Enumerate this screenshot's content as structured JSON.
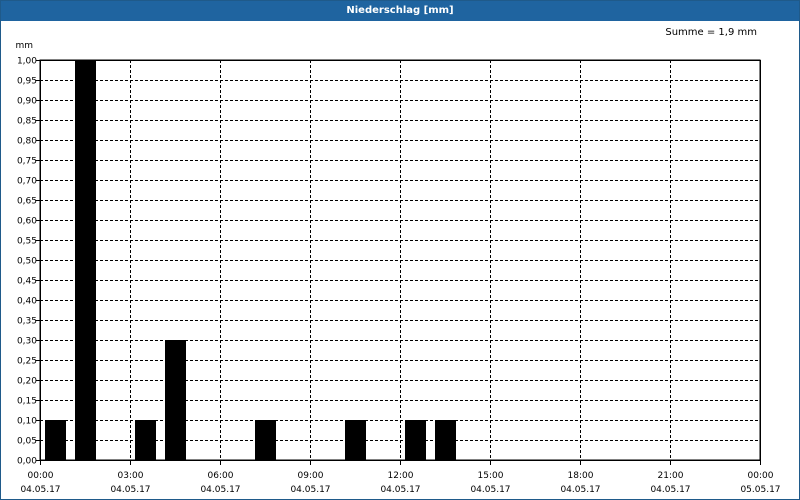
{
  "window": {
    "title": "Niederschlag [mm]"
  },
  "summary": "Summe = 1,9 mm",
  "chart_data": {
    "type": "bar",
    "title": "Niederschlag [mm]",
    "ylabel": "mm",
    "ylim": [
      0,
      1.0
    ],
    "y_ticks": [
      "0,00",
      "0,05",
      "0,10",
      "0,15",
      "0,20",
      "0,25",
      "0,30",
      "0,35",
      "0,40",
      "0,45",
      "0,50",
      "0,55",
      "0,60",
      "0,65",
      "0,70",
      "0,75",
      "0,80",
      "0,85",
      "0,90",
      "0,95",
      "1,00"
    ],
    "x_ticks": [
      {
        "time": "00:00",
        "date": "04.05.17"
      },
      {
        "time": "03:00",
        "date": "04.05.17"
      },
      {
        "time": "06:00",
        "date": "04.05.17"
      },
      {
        "time": "09:00",
        "date": "04.05.17"
      },
      {
        "time": "12:00",
        "date": "04.05.17"
      },
      {
        "time": "15:00",
        "date": "04.05.17"
      },
      {
        "time": "18:00",
        "date": "04.05.17"
      },
      {
        "time": "21:00",
        "date": "04.05.17"
      },
      {
        "time": "00:00",
        "date": "05.05.17"
      }
    ],
    "grid": true,
    "bar_color": "#000000",
    "bars": [
      {
        "time": "04.05.17 00:00",
        "value": 0.1
      },
      {
        "time": "04.05.17 01:00",
        "value": 1.0
      },
      {
        "time": "04.05.17 03:00",
        "value": 0.1
      },
      {
        "time": "04.05.17 04:00",
        "value": 0.3
      },
      {
        "time": "04.05.17 07:00",
        "value": 0.1
      },
      {
        "time": "04.05.17 10:00",
        "value": 0.1
      },
      {
        "time": "04.05.17 12:00",
        "value": 0.1
      },
      {
        "time": "04.05.17 13:00",
        "value": 0.1
      }
    ]
  }
}
